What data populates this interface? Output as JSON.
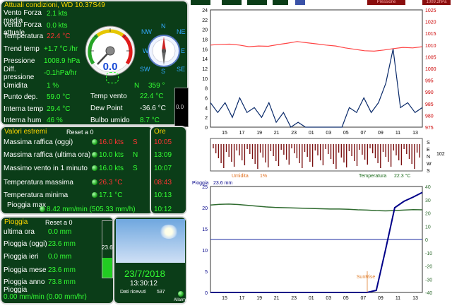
{
  "current": {
    "title": "Attuali condizioni, WD 10.37S49",
    "rows": [
      {
        "label": "Vento Forza media",
        "value": "2.1 kts",
        "color": "green"
      },
      {
        "label": "Vento Forza attuale",
        "value": "0.0 kts",
        "color": "green"
      },
      {
        "label": "Temperatura",
        "value": "22.4 °C",
        "color": "red"
      },
      {
        "label": "Trend temp",
        "value": "+1.7 °C /hr",
        "color": "green"
      },
      {
        "label": "Pressione",
        "value": "1008.9 hPa",
        "color": "green"
      },
      {
        "label": "Diff. pressione",
        "value": "-0.1hPa/hr",
        "color": "green"
      },
      {
        "label": "Umidita",
        "value": "1 %",
        "color": "green"
      },
      {
        "label": "Punto dep.",
        "value": "59.0 °C",
        "color": "green"
      },
      {
        "label": "Interna temp",
        "value": "29.4 °C",
        "color": "green"
      },
      {
        "label": "Interna hum",
        "value": "46 %",
        "color": "green"
      }
    ],
    "right_rows": [
      {
        "label": "Temp vento",
        "value": "22.4 °C",
        "color": "green"
      },
      {
        "label": "Dew Point",
        "value": "-36.6 °C",
        "color": "white"
      },
      {
        "label": "Bulbo umido",
        "value": "8.7 °C",
        "color": "green"
      }
    ],
    "gauge_value": "0.0",
    "compass": {
      "n": "N",
      "nw": "NW",
      "ne": "NE",
      "sw": "SW",
      "s": "S",
      "se": "SE",
      "w": "W",
      "e": "E"
    },
    "direction_label": "N",
    "direction_value": "359 °",
    "side_value": "0.0"
  },
  "extremes": {
    "title": "Valori estremi",
    "reset": "Reset a 0",
    "ore_title": "Ore",
    "rows": [
      {
        "label": "Massima raffica (oggi)",
        "value": "16.0 kts",
        "dir": "S",
        "time": "10:05",
        "color": "red",
        "time_color": "red"
      },
      {
        "label": "Massima raffica (ultima ora)",
        "value": "10.0 kts",
        "dir": "N",
        "time": "13:09",
        "color": "green",
        "time_color": "green"
      },
      {
        "label": "Massimo vento in 1 minuto",
        "value": "16.0 kts",
        "dir": "S",
        "time": "10:07",
        "color": "green",
        "time_color": "green"
      },
      {
        "label": "Temperatura massima",
        "value": "26.3 °C",
        "dir": "",
        "time": "08:43",
        "color": "red",
        "time_color": "red"
      },
      {
        "label": "Temperatura minima",
        "value": "17.1 °C",
        "dir": "",
        "time": "10:13",
        "color": "green",
        "time_color": "green"
      }
    ],
    "pioggia_label": "Pioggia max",
    "pioggia_value": "8.42 mm/min (505.33 mm/h)",
    "pioggia_time": "10:12"
  },
  "rain": {
    "title": "Pioggia",
    "reset": "Reset a 0",
    "rows": [
      {
        "label": "ultima ora",
        "value": "0.0 mm"
      },
      {
        "label": "Pioggia (oggi)",
        "value": "23.6 mm"
      },
      {
        "label": "Pioggia ieri",
        "value": "0.0 mm"
      },
      {
        "label": "Pioggia mese",
        "value": "23.6 mm"
      },
      {
        "label": "Pioggia anno",
        "value": "73.8 mm"
      }
    ],
    "bottom_label": "Pioggia",
    "bottom_value": "0.00 mm/min (0.00 mm/hr)",
    "bar_label": "23.6",
    "bar_fill": 0.35
  },
  "sky": {
    "date": "23/7/2018",
    "time": "13:30:12",
    "dati_label": "Dati ricevuti",
    "dati_value": "537",
    "allarme": "Allarme"
  },
  "top_tabs": {
    "left_items": [
      "",
      "",
      "",
      "",
      ""
    ],
    "pressione": "Pressione",
    "pressione_value": "1009.2hPa"
  },
  "chart_data": [
    {
      "type": "line",
      "title": "",
      "x_ticks": [
        "15",
        "17",
        "19",
        "21",
        "23",
        "01",
        "03",
        "05",
        "07",
        "09",
        "11",
        "13"
      ],
      "yleft_ticks": [
        "0",
        "2",
        "4",
        "6",
        "8",
        "10",
        "12",
        "14",
        "16",
        "18",
        "20",
        "22",
        "24"
      ],
      "yright_ticks": [
        "975",
        "980",
        "985",
        "990",
        "995",
        "1000",
        "1005",
        "1010",
        "1015",
        "1020",
        "1025"
      ],
      "ylim_left": [
        0,
        24
      ],
      "ylim_right": [
        975,
        1025
      ],
      "series": [
        {
          "name": "",
          "values": [
            1010,
            1010.3,
            1010.4,
            1010,
            1009.3,
            1009.6,
            1009.5,
            1010.2,
            1010.8,
            1011.5,
            1011,
            1010.5,
            1010,
            1009.6,
            1008.8,
            1008.2,
            1007.6,
            1007.4,
            1007.9,
            1008.5,
            1009,
            1008.8,
            1009.3
          ],
          "color": "#ff4444"
        },
        {
          "name": "",
          "values": [
            5,
            3,
            5,
            2,
            6,
            3,
            4,
            2,
            5,
            1,
            3,
            0,
            1,
            0,
            0,
            0,
            0,
            0,
            0,
            4,
            3,
            6,
            3,
            5,
            9,
            16,
            4,
            5,
            3,
            4
          ],
          "color": "#0a2a6a"
        }
      ]
    },
    {
      "type": "bar",
      "title": "",
      "labels_left": [
        "Umidita",
        "1%"
      ],
      "labels_right": [
        "Temperatura",
        "22.3 °C"
      ],
      "compass_axis": [
        "S",
        "E",
        "N",
        "W",
        "S"
      ],
      "compass_value": "102",
      "ylim": [
        0,
        360
      ]
    },
    {
      "type": "line",
      "title": "",
      "rain_label": "Pioggia",
      "rain_value": "23.6 mm",
      "sunrise": "SunRise",
      "x_ticks": [
        "15",
        "17",
        "19",
        "21",
        "23",
        "01",
        "03",
        "05",
        "07",
        "09",
        "11",
        "13"
      ],
      "yleft_ticks": [
        "0",
        "5",
        "10",
        "15",
        "20",
        "25"
      ],
      "yright_ticks": [
        "-40",
        "-30",
        "-20",
        "-10",
        "0",
        "10",
        "20",
        "30",
        "40"
      ],
      "ylim_left": [
        0,
        25
      ],
      "ylim_right": [
        -40,
        40
      ],
      "series": [
        {
          "name": "",
          "values": [
            26,
            26.5,
            26.7,
            26.4,
            25.8,
            25.2,
            24.6,
            24.2,
            24,
            23.8,
            23.6,
            23.4,
            23.2,
            23,
            23,
            22.8,
            22.4,
            22.2,
            21.8,
            21.6,
            21.8,
            22.2,
            22.5,
            22.4
          ],
          "color": "#2f6b2f"
        },
        {
          "name": "",
          "values": [
            0,
            0,
            0,
            0,
            0,
            0,
            0,
            0,
            0,
            0,
            0,
            0,
            0,
            0,
            0,
            0,
            0,
            0,
            0.5,
            10,
            20,
            21.5,
            22.5,
            23.6
          ],
          "color": "#000088"
        }
      ]
    }
  ]
}
